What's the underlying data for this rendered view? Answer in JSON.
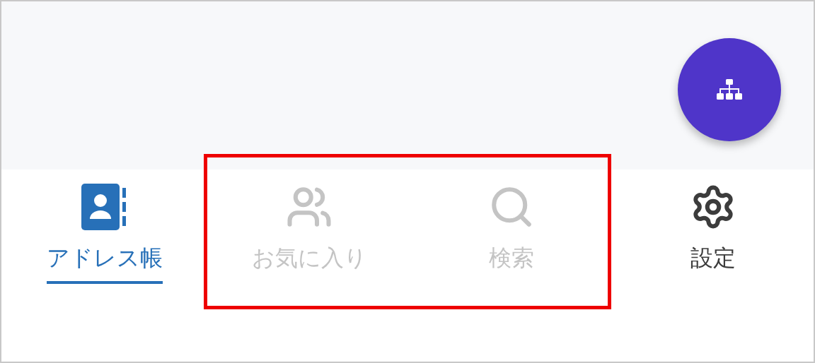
{
  "tabs": [
    {
      "kind": "addressbook",
      "label": "アドレス帳",
      "selected": true,
      "disabled": false
    },
    {
      "kind": "people",
      "label": "お気に入り",
      "selected": false,
      "disabled": true
    },
    {
      "kind": "search",
      "label": "検索",
      "selected": false,
      "disabled": true
    },
    {
      "kind": "settings",
      "label": "設定",
      "selected": false,
      "disabled": false
    }
  ]
}
